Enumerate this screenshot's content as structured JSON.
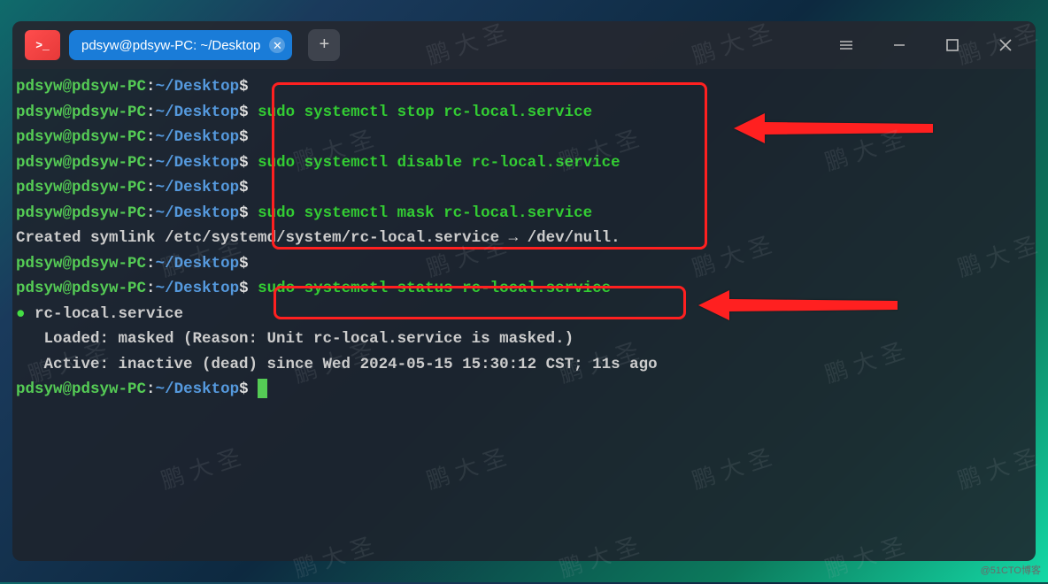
{
  "tab": {
    "title": "pdsyw@pdsyw-PC: ~/Desktop"
  },
  "app_icon_glyph": ">_",
  "prompt": {
    "user": "pdsyw",
    "host": "pdsyw-PC",
    "path": "~/Desktop",
    "dollar": "$"
  },
  "lines": {
    "l1_cmd": "",
    "l2_cmd": " sudo systemctl stop rc-local.service",
    "l3_cmd": "",
    "l4_cmd": " sudo systemctl disable rc-local.service",
    "l5_cmd": "",
    "l6_cmd": " sudo systemctl mask rc-local.service",
    "l7_out": "Created symlink /etc/systemd/system/rc-local.service → /dev/null.",
    "l8_cmd": "",
    "l9_cmd": " sudo systemctl status rc-local.service",
    "l10_bullet": "●",
    "l10_out": " rc-local.service",
    "l11_out": "   Loaded: masked (Reason: Unit rc-local.service is masked.)",
    "l12_out": "   Active: inactive (dead) since Wed 2024-05-15 15:30:12 CST; 11s ago",
    "l13_cmd": ""
  },
  "watermark": "鹏 大 圣",
  "credit": "@51CTO博客"
}
